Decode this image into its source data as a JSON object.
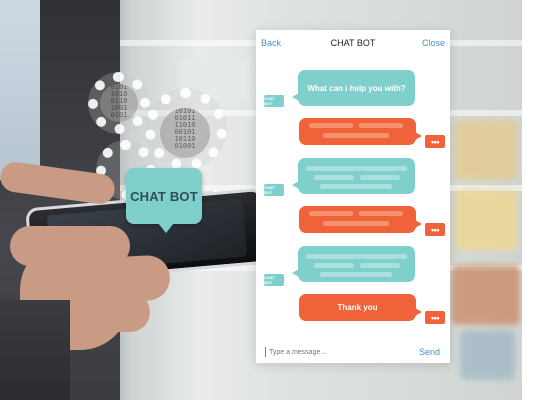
{
  "badge": {
    "label": "CHAT BOT"
  },
  "chat": {
    "header": {
      "back": "Back",
      "title": "CHAT BOT",
      "close": "Close"
    },
    "bot_tag": "CHAT BOT",
    "user_tag": "•••",
    "messages": [
      {
        "sender": "bot",
        "text": "What can i help you with?"
      },
      {
        "sender": "user",
        "text": ""
      },
      {
        "sender": "bot",
        "text": ""
      },
      {
        "sender": "user",
        "text": ""
      },
      {
        "sender": "bot",
        "text": ""
      },
      {
        "sender": "user",
        "text": "Thank you"
      }
    ],
    "input": {
      "placeholder": "Type a message...",
      "send": "Send"
    }
  },
  "colors": {
    "bot_bubble": "#7fcfcc",
    "user_bubble": "#f0623a",
    "link": "#4a90c8"
  }
}
